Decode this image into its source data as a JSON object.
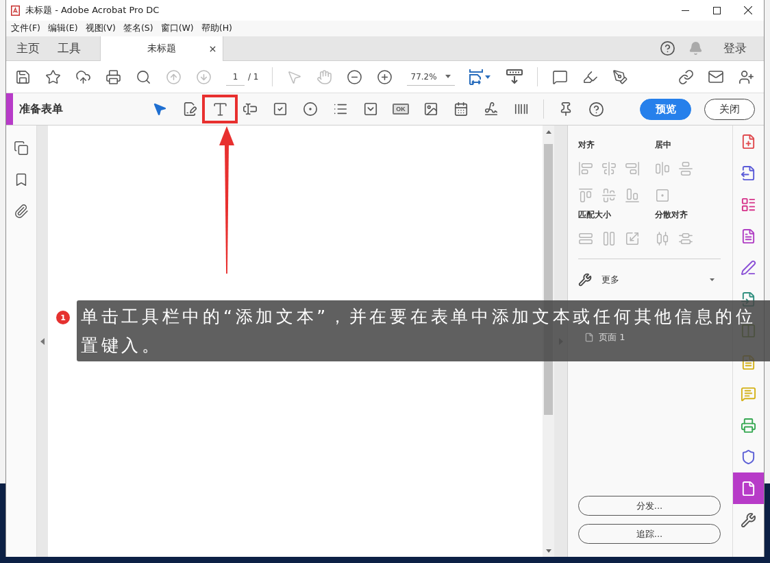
{
  "window": {
    "title": "未标题 - Adobe Acrobat Pro DC"
  },
  "menu": [
    "文件(F)",
    "编辑(E)",
    "视图(V)",
    "签名(S)",
    "窗口(W)",
    "帮助(H)"
  ],
  "tabs": [
    {
      "label": "主页",
      "kind": "nav",
      "selected": false
    },
    {
      "label": "工具",
      "kind": "nav",
      "selected": false
    },
    {
      "label": "未标题",
      "kind": "document",
      "selected": true
    }
  ],
  "account": {
    "sign_in": "登录"
  },
  "toolbar": {
    "navigation": [
      {
        "kind": "save",
        "disabled": false
      },
      {
        "kind": "star",
        "disabled": false
      },
      {
        "kind": "upload",
        "disabled": false
      },
      {
        "kind": "print",
        "disabled": false
      },
      {
        "kind": "search",
        "disabled": false
      },
      {
        "kind": "previous-page",
        "disabled": true
      },
      {
        "kind": "next-page",
        "disabled": true
      }
    ],
    "page_number": "1",
    "page_total": "/ 1",
    "view_tools": [
      {
        "kind": "select",
        "disabled": true
      },
      {
        "kind": "hand",
        "disabled": true
      },
      {
        "kind": "zoom-out",
        "disabled": false
      },
      {
        "kind": "zoom-in",
        "disabled": false
      }
    ],
    "zoom": "77.2%"
  },
  "form_toolbar": {
    "title": "准备表单",
    "tools": [
      {
        "kind": "select",
        "annotated": false
      },
      {
        "kind": "edit-form",
        "annotated": false
      },
      {
        "kind": "text",
        "annotated": true
      },
      {
        "kind": "text-field",
        "annotated": false
      },
      {
        "kind": "checkbox",
        "annotated": false
      },
      {
        "kind": "radio",
        "annotated": false
      },
      {
        "kind": "list-box",
        "annotated": false
      },
      {
        "kind": "dropdown",
        "annotated": false
      },
      {
        "kind": "button",
        "label": "OK",
        "annotated": false
      },
      {
        "kind": "image",
        "annotated": false
      },
      {
        "kind": "date",
        "annotated": false
      },
      {
        "kind": "signature",
        "annotated": false
      },
      {
        "kind": "barcode",
        "annotated": false
      }
    ],
    "actions": [
      {
        "label": "预览",
        "kind": "primary"
      },
      {
        "label": "关闭",
        "kind": "secondary"
      }
    ]
  },
  "align_panel": {
    "disabled": true,
    "sections": [
      {
        "title": "对齐",
        "rows": [
          [
            {
              "kind": "align-left"
            },
            {
              "kind": "align-center"
            },
            {
              "kind": "align-right"
            }
          ],
          [
            {
              "kind": "align-top"
            },
            {
              "kind": "align-middle"
            },
            {
              "kind": "align-bottom"
            }
          ]
        ]
      },
      {
        "title": "居中",
        "rows": [
          [
            {
              "kind": "center-horizontal"
            },
            {
              "kind": "center-vertical"
            }
          ],
          [
            {
              "kind": "center-both"
            }
          ]
        ]
      },
      {
        "title": "匹配大小",
        "rows": [
          [
            {
              "kind": "match-width"
            },
            {
              "kind": "match-height"
            },
            {
              "kind": "match-both"
            }
          ]
        ]
      },
      {
        "title": "分散对齐",
        "rows": [
          [
            {
              "kind": "distribute-horizontal"
            },
            {
              "kind": "distribute-vertical"
            }
          ]
        ]
      }
    ]
  },
  "more": {
    "label": "更多"
  },
  "fields": [
    {
      "label": "页面 1"
    }
  ],
  "panel_buttons": [
    "分发...",
    "追踪..."
  ],
  "tool_rail": [
    {
      "kind": "create-pdf",
      "selected": false
    },
    {
      "kind": "export-pdf",
      "selected": false
    },
    {
      "kind": "organize-pages",
      "selected": false
    },
    {
      "kind": "edit-pdf",
      "selected": false
    },
    {
      "kind": "fill-sign",
      "selected": false
    },
    {
      "kind": "send-review",
      "selected": false
    },
    {
      "kind": "compare",
      "selected": false
    },
    {
      "kind": "review",
      "selected": false
    },
    {
      "kind": "comment",
      "selected": false
    },
    {
      "kind": "print-production",
      "selected": false
    },
    {
      "kind": "protect",
      "selected": false
    },
    {
      "kind": "prepare-form",
      "selected": true
    },
    {
      "kind": "more-tools",
      "selected": false
    }
  ],
  "annotation": {
    "step": "1",
    "lines": [
      "单击工具栏中的“添加文本”，并在要在表单中添加文本或任何其他信息的位",
      "置键入。"
    ]
  }
}
